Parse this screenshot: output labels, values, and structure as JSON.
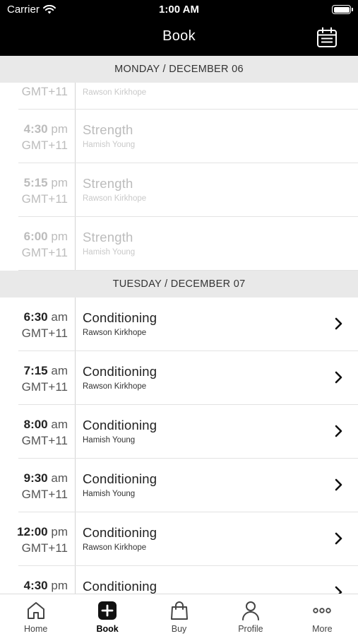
{
  "status_bar": {
    "carrier": "Carrier",
    "time": "1:00 AM"
  },
  "nav": {
    "title": "Book"
  },
  "sections": [
    {
      "header": "MONDAY / DECEMBER 06",
      "partial_top": {
        "tz": "GMT+11",
        "instructor": "Rawson Kirkhope"
      },
      "rows": [
        {
          "time": "4:30",
          "ampm": "pm",
          "tz": "GMT+11",
          "class": "Strength",
          "instructor": "Hamish Young"
        },
        {
          "time": "5:15",
          "ampm": "pm",
          "tz": "GMT+11",
          "class": "Strength",
          "instructor": "Rawson Kirkhope"
        },
        {
          "time": "6:00",
          "ampm": "pm",
          "tz": "GMT+11",
          "class": "Strength",
          "instructor": "Hamish Young"
        }
      ]
    },
    {
      "header": "TUESDAY / DECEMBER 07",
      "rows": [
        {
          "time": "6:30",
          "ampm": "am",
          "tz": "GMT+11",
          "class": "Conditioning",
          "instructor": "Rawson Kirkhope"
        },
        {
          "time": "7:15",
          "ampm": "am",
          "tz": "GMT+11",
          "class": "Conditioning",
          "instructor": "Rawson Kirkhope"
        },
        {
          "time": "8:00",
          "ampm": "am",
          "tz": "GMT+11",
          "class": "Conditioning",
          "instructor": "Hamish Young"
        },
        {
          "time": "9:30",
          "ampm": "am",
          "tz": "GMT+11",
          "class": "Conditioning",
          "instructor": "Hamish Young"
        },
        {
          "time": "12:00",
          "ampm": "pm",
          "tz": "GMT+11",
          "class": "Conditioning",
          "instructor": "Rawson Kirkhope"
        },
        {
          "time": "4:30",
          "ampm": "pm",
          "tz": "",
          "class": "Conditioning",
          "instructor": ""
        }
      ]
    }
  ],
  "tabbar": {
    "items": [
      {
        "label": "Home",
        "icon": "home-icon"
      },
      {
        "label": "Book",
        "icon": "plus-square-icon",
        "active": true
      },
      {
        "label": "Buy",
        "icon": "shopping-bag-icon"
      },
      {
        "label": "Profile",
        "icon": "person-icon"
      },
      {
        "label": "More",
        "icon": "more-dots-icon"
      }
    ]
  },
  "colors": {
    "header_bg": "#000000",
    "section_bg": "#e9e9e9",
    "past_text": "#bcbcbc"
  }
}
